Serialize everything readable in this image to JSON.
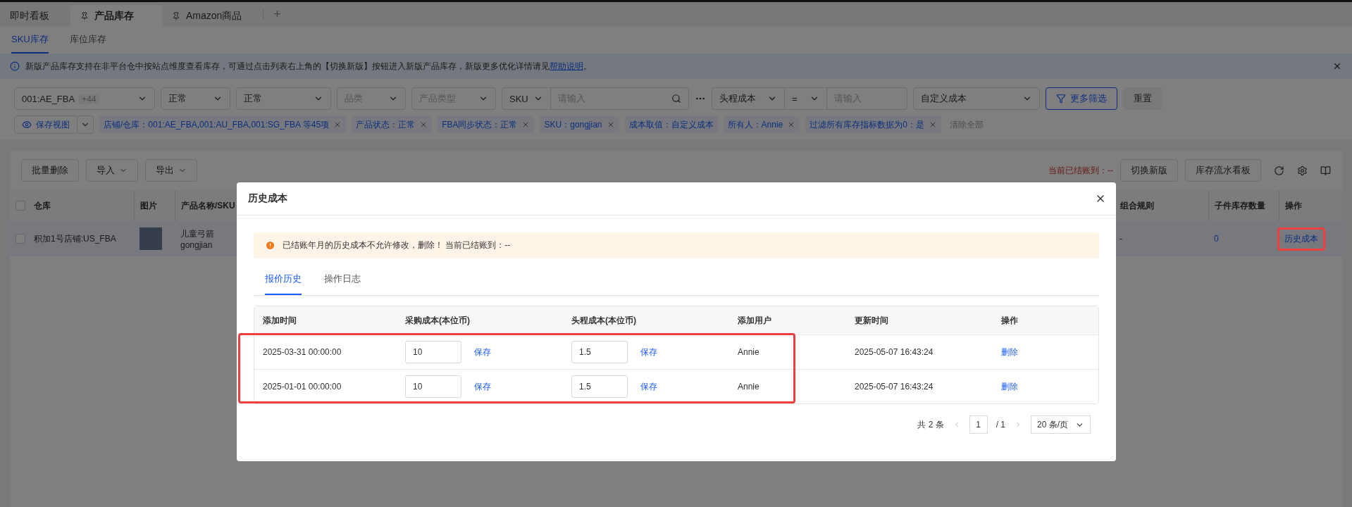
{
  "top_tabs": [
    {
      "label": "即时看板",
      "selected": false,
      "pinned": false
    },
    {
      "label": "产品库存",
      "selected": true,
      "pinned": true
    },
    {
      "label": "Amazon商品",
      "selected": false,
      "pinned": true
    }
  ],
  "add_tab": "+",
  "sub_tabs": [
    {
      "label": "SKU库存",
      "selected": true
    },
    {
      "label": "库位库存",
      "selected": false
    }
  ],
  "notice": {
    "text": "新版产品库存支持在非平台仓中按站点维度查看库存，可通过点击列表右上角的【切换新版】按钮进入新版产品库存，新版更多优化详情请见",
    "link": "帮助说明",
    "end": "。"
  },
  "filters": [
    {
      "kind": "select",
      "value": "001:AE_FBA",
      "count": "+44"
    },
    {
      "kind": "select",
      "value": "正常"
    },
    {
      "kind": "select",
      "value": "正常"
    },
    {
      "kind": "select",
      "placeholder": "品类"
    },
    {
      "kind": "select",
      "placeholder": "产品类型"
    },
    {
      "kind": "search",
      "field": "SKU",
      "placeholder": "请输入"
    },
    {
      "kind": "compare",
      "field": "头程成本",
      "operator": "=",
      "placeholder": "请输入"
    },
    {
      "kind": "select",
      "value": "自定义成本"
    }
  ],
  "more_filters_button": "更多筛选",
  "reset_button": "重置",
  "save_view_button": "保存视图",
  "chips": [
    {
      "label": "店铺/仓库：001:AE_FBA,001:AU_FBA,001:SG_FBA 等45项",
      "closable": true
    },
    {
      "label": "产品状态：正常",
      "closable": true
    },
    {
      "label": "FBA同步状态：正常",
      "closable": true
    },
    {
      "label": "SKU：gongjian",
      "closable": true
    },
    {
      "label": "成本取值：自定义成本",
      "closable": false
    },
    {
      "label": "所有人：Annie",
      "closable": true
    },
    {
      "label": "过滤所有库存指标数据为0：是",
      "closable": true
    }
  ],
  "clear_all": "清除全部",
  "toolbar": {
    "buttons": [
      {
        "label": "批量删除",
        "dropdown": false
      },
      {
        "label": "导入",
        "dropdown": true
      },
      {
        "label": "导出",
        "dropdown": true
      }
    ],
    "closing_status": "当前已结账到：--",
    "right_buttons": [
      "切换新版",
      "库存流水看板"
    ]
  },
  "table": {
    "select_all_checked": false,
    "columns": [
      "仓库",
      "图片",
      "产品名称/SKU",
      "组合规则",
      "子件库存数量",
      "操作"
    ],
    "rows": [
      {
        "checked": false,
        "warehouse": "积加1号店铺:US_FBA",
        "name": "儿童弓箭",
        "sku": "gongjian",
        "combo_rule": "-",
        "child_stock": "0",
        "action": "历史成本",
        "highlighted": true
      }
    ]
  },
  "modal": {
    "title": "历史成本",
    "alert": "已结账年月的历史成本不允许修改，删除！ 当前已结账到：--",
    "tabs": [
      {
        "label": "报价历史",
        "selected": true
      },
      {
        "label": "操作日志",
        "selected": false
      }
    ],
    "columns": [
      "添加时间",
      "采购成本(本位币)",
      "头程成本(本位币)",
      "添加用户",
      "更新时间",
      "操作"
    ],
    "rows": [
      {
        "added": "2025-03-31 00:00:00",
        "purchase_cost": "10",
        "purchase_save": "保存",
        "freight_cost": "1.5",
        "freight_save": "保存",
        "user": "Annie",
        "updated": "2025-05-07 16:43:24",
        "action": "删除"
      },
      {
        "added": "2025-01-01 00:00:00",
        "purchase_cost": "10",
        "purchase_save": "保存",
        "freight_cost": "1.5",
        "freight_save": "保存",
        "user": "Annie",
        "updated": "2025-05-07 16:43:24",
        "action": "删除"
      }
    ],
    "rows_highlighted": true,
    "pagination": {
      "total": "共 2 条",
      "page": "1",
      "pages": "/ 1",
      "page_size": "20 条/页"
    }
  }
}
